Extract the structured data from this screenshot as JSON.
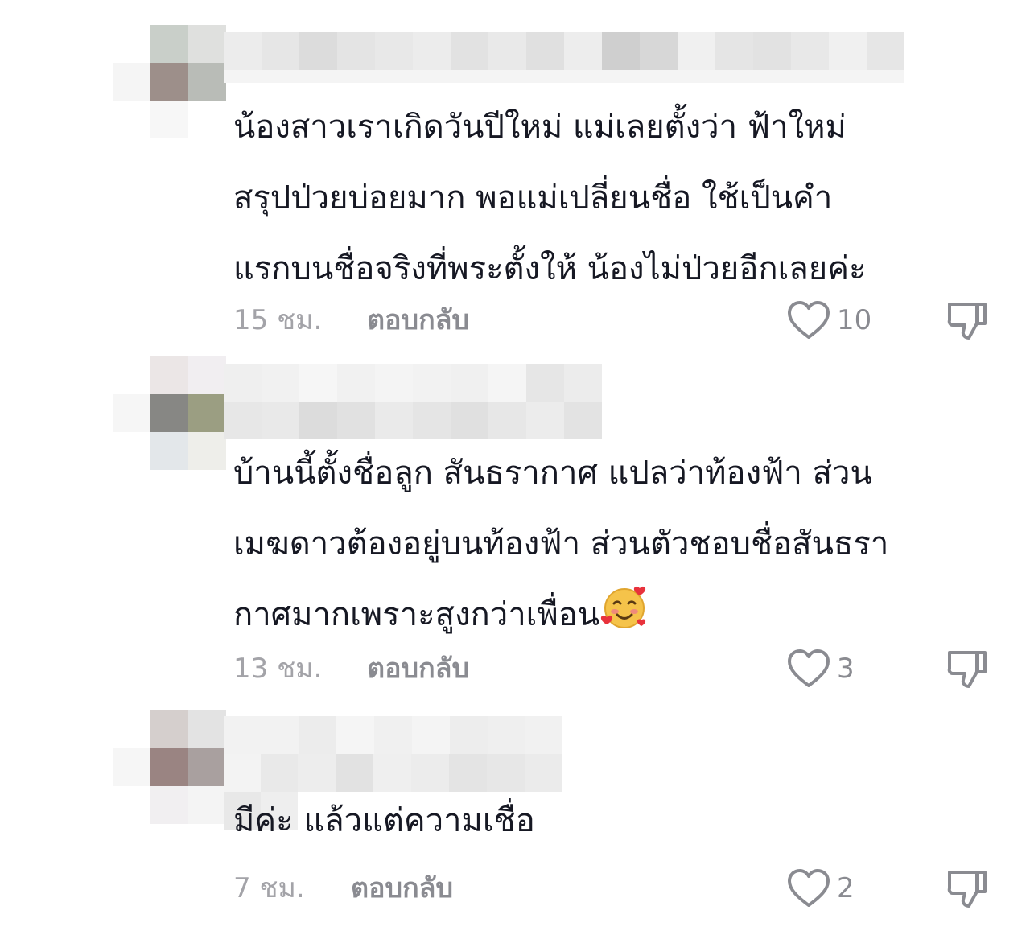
{
  "comments": [
    {
      "text": "น้องสาวเราเกิดวันปีใหม่ แม่เลยตั้งว่า ฟ้าใหม่\nสรุปป่วยบ่อยมาก พอแม่เปลี่ยนชื่อ ใช้เป็นคำ\nแรกบนชื่อจริงที่พระตั้งให้ น้องไม่ป่วยอีกเลยค่ะ",
      "time": "15 ชม.",
      "reply_label": "ตอบกลับ",
      "likes": "10",
      "emoji": ""
    },
    {
      "text": "บ้านนี้ตั้งชื่อลูก สันธรากาศ แปลว่าท้องฟ้า ส่วน\nเมฆดาวต้องอยู่บนท้องฟ้า ส่วนตัวชอบชื่อสันธรา\nกาศมากเพราะสูงกว่าเพื่อน",
      "time": "13 ชม.",
      "reply_label": "ตอบกลับ",
      "likes": "3",
      "emoji": "smiling-face-with-hearts"
    },
    {
      "text": "มีค่ะ แล้วแต่ความเชื่อ",
      "time": "7 ชม.",
      "reply_label": "ตอบกลับ",
      "likes": "2",
      "emoji": ""
    }
  ],
  "colors": {
    "text": "#161823",
    "meta": "#a3a3a8",
    "icon": "#8a8b91"
  }
}
